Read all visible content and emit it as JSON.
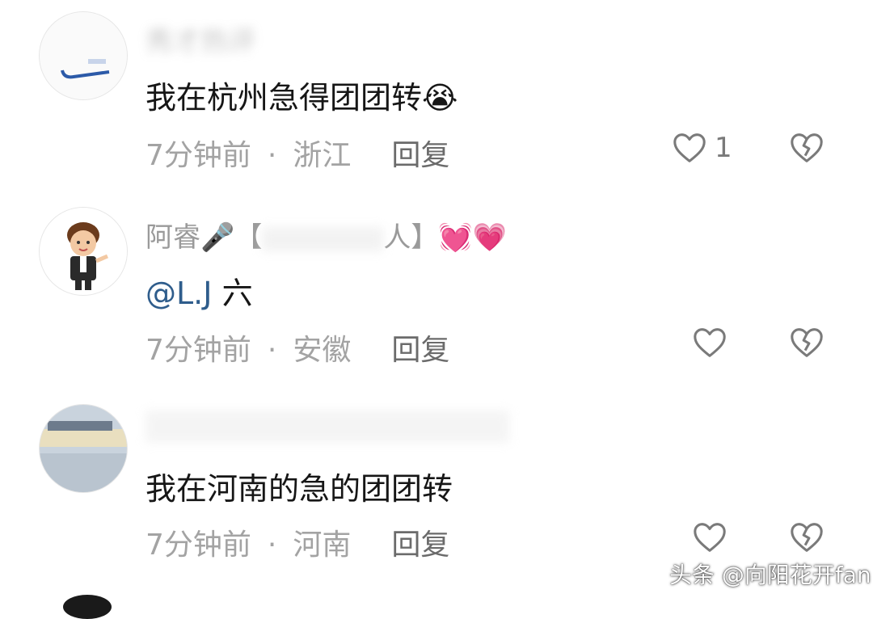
{
  "comments": [
    {
      "username": "秀才热评",
      "content": "我在杭州急得团团转😭",
      "time": "7分钟前",
      "location": "浙江",
      "reply_label": "回复",
      "like_count": "1"
    },
    {
      "username": "阿睿🎤【",
      "username_tail": "人】💓💗",
      "mention": "@L.J",
      "content": "六",
      "time": "7分钟前",
      "location": "安徽",
      "reply_label": "回复",
      "like_count": ""
    },
    {
      "username": "",
      "content": "我在河南的急的团团转",
      "time": "7分钟前",
      "location": "河南",
      "reply_label": "回复",
      "like_count": ""
    }
  ],
  "separator": "·",
  "watermark": "头条 @向阳花开fan",
  "icons": {
    "like": "heart-outline-icon",
    "dislike": "broken-heart-icon"
  },
  "colors": {
    "meta": "#a3a3a3",
    "mention": "#2f5d8c",
    "icon": "#7a7a7a"
  }
}
